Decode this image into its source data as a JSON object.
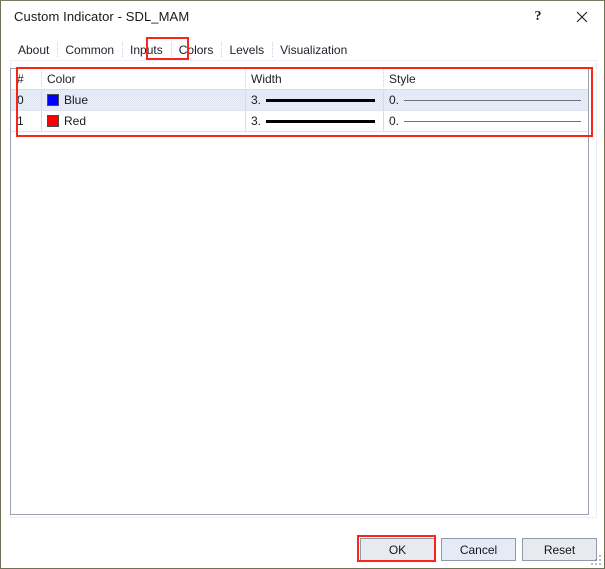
{
  "window": {
    "title": "Custom Indicator - SDL_MAM",
    "help_label": "?",
    "close_label": "✕",
    "help_icon": "question-mark-icon",
    "close_icon": "close-x-icon"
  },
  "tabs": [
    {
      "label": "About",
      "active": false
    },
    {
      "label": "Common",
      "active": false
    },
    {
      "label": "Inputs",
      "active": false
    },
    {
      "label": "Colors",
      "active": true
    },
    {
      "label": "Levels",
      "active": false
    },
    {
      "label": "Visualization",
      "active": false
    }
  ],
  "grid": {
    "columns": [
      "#",
      "Color",
      "Width",
      "Style"
    ],
    "rows": [
      {
        "index": "0",
        "color_name": "Blue",
        "color_hex": "#0000FF",
        "width_value": "3.",
        "style_value": "0.",
        "selected": true
      },
      {
        "index": "1",
        "color_name": "Red",
        "color_hex": "#FF0000",
        "width_value": "3.",
        "style_value": "0.",
        "selected": false
      }
    ]
  },
  "footer": {
    "ok_label": "OK",
    "cancel_label": "Cancel",
    "reset_label": "Reset"
  },
  "annotations": {
    "accent_color": "#FB2418",
    "highlighted": [
      "Colors tab",
      "color table",
      "OK button"
    ]
  }
}
